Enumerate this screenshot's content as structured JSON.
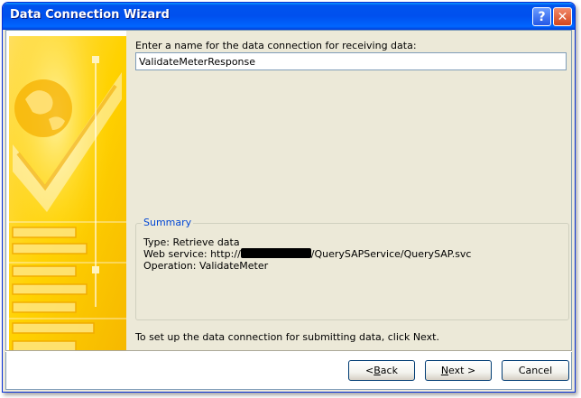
{
  "window": {
    "title": "Data Connection Wizard"
  },
  "titlebar": {
    "help_glyph": "?",
    "close_glyph": "✕"
  },
  "prompt": {
    "label": "Enter a name for the data connection for receiving data:"
  },
  "name_field": {
    "value": "ValidateMeterResponse"
  },
  "summary": {
    "legend": "Summary",
    "type_line": "Type: Retrieve data",
    "web_service_prefix": "Web service: http://",
    "web_service_suffix": "/QuerySAPService/QuerySAP.svc",
    "operation_line": "Operation: ValidateMeter"
  },
  "instructions": {
    "text": "To set up the data connection for submitting data, click Next."
  },
  "buttons": {
    "back": {
      "mnemonic": "B",
      "rest": "ack",
      "prefix": "< "
    },
    "next": {
      "mnemonic": "N",
      "rest": "ext >"
    },
    "cancel": {
      "label": "Cancel"
    }
  },
  "colors": {
    "titlebar": "#0053ee",
    "banner_yellow": "#ffd200",
    "banner_orange": "#f8b400",
    "summary_legend": "#0046d5"
  },
  "icons": {
    "help": "help-icon",
    "close": "close-icon"
  }
}
